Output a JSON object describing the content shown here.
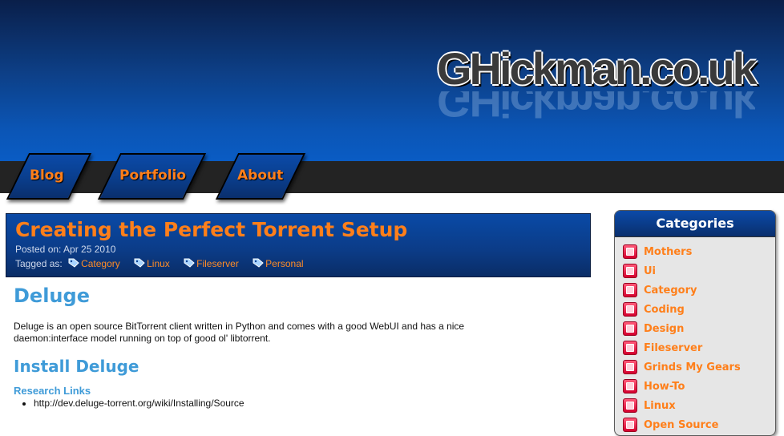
{
  "site": {
    "logo_text": "GHickman.co.uk"
  },
  "nav": {
    "items": [
      {
        "label": "Blog"
      },
      {
        "label": "Portfolio"
      },
      {
        "label": "About"
      }
    ]
  },
  "post": {
    "title": "Creating the Perfect Torrent Setup",
    "posted_prefix": "Posted on:",
    "posted_date": "Apr 25 2010",
    "tagged_prefix": "Tagged as:",
    "tags": [
      "Category",
      "Linux",
      "Fileserver",
      "Personal"
    ]
  },
  "content": {
    "heading": "Deluge",
    "paragraph": "Deluge is an open source BitTorrent client written in Python and comes with a good WebUI and has a nice daemon:interface model running on top of good ol' libtorrent.",
    "subheading": "Install Deluge",
    "research_heading": "Research Links",
    "links": [
      "http://dev.deluge-torrent.org/wiki/Installing/Source"
    ]
  },
  "sidebar": {
    "title": "Categories",
    "items": [
      {
        "label": "Mothers"
      },
      {
        "label": "Ui"
      },
      {
        "label": "Category"
      },
      {
        "label": "Coding"
      },
      {
        "label": "Design"
      },
      {
        "label": "Fileserver"
      },
      {
        "label": "Grinds My Gears"
      },
      {
        "label": "How-To"
      },
      {
        "label": "Linux"
      },
      {
        "label": "Open Source"
      }
    ]
  },
  "colors": {
    "accent_orange": "#ff7f1a",
    "heading_blue": "#3f9bd8",
    "header_blue": "#0b55b5",
    "nav_bar": "#232323"
  }
}
